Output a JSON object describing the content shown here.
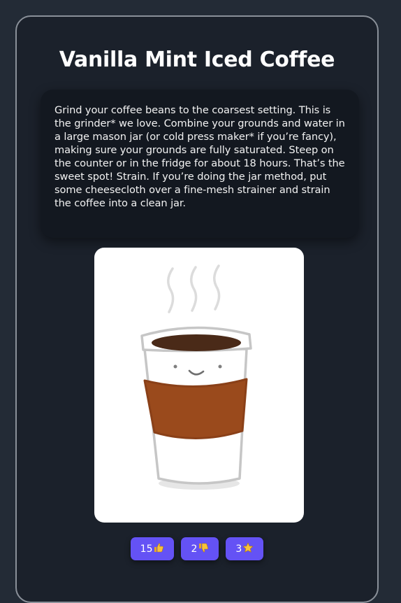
{
  "recipe": {
    "title": "Vanilla Mint Iced Coffee",
    "description": "Grind your coffee beans to the coarsest setting. This is the grinder* we love. Combine your grounds and water in a large mason jar (or cold press maker* if you’re fancy), making sure your grounds are fully saturated. Steep on the counter or in the fridge for about 18 hours. That’s the sweet spot! Strain. If you’re doing the jar method, put some cheesecloth over a fine-mesh strainer and strain the coffee into a clean jar.",
    "image_icon": "coffee-cup-illustration"
  },
  "actions": {
    "likes": {
      "count": "15",
      "icon": "thumbs-up-icon"
    },
    "dislikes": {
      "count": "2",
      "icon": "thumbs-down-icon"
    },
    "favorites": {
      "count": "3",
      "icon": "star-icon"
    }
  },
  "colors": {
    "page_background": "#232b36",
    "card_background": "#1b212b",
    "card_border": "#8a9099",
    "description_background": "#131820",
    "button_background": "#6452f5",
    "sleeve": "#9a4a1c",
    "coffee": "#4a2a18",
    "emoji_yellow": "#f7c23a"
  }
}
